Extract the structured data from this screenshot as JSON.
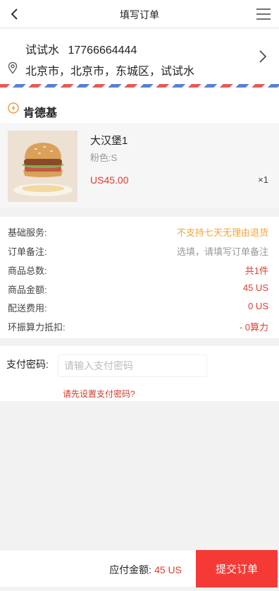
{
  "header": {
    "title": "填写订单",
    "back_icon": "back-arrow-icon",
    "menu_icon": "hamburger-menu-icon"
  },
  "address": {
    "name": "试试水",
    "phone": "17766664444",
    "full_address": "北京市，北京市，东城区，试试水",
    "pin_icon": "location-pin-icon",
    "arrow_icon": "chevron-right-icon"
  },
  "shop": {
    "name": "肯德基",
    "icon": "lightning-icon",
    "accent": "#f28a2e"
  },
  "product": {
    "name": "大汉堡1",
    "variant": "粉色:S",
    "price": "US45.00",
    "quantity": "×1"
  },
  "details": [
    {
      "label": "基础服务:",
      "value": "不支持七天无理由退货",
      "tone": "orange"
    },
    {
      "label": "订单备注:",
      "value": "选填，请填写订单备注",
      "tone": "gray"
    },
    {
      "label": "商品总数:",
      "value": "共1件",
      "tone": "red"
    },
    {
      "label": "商品金额:",
      "value": "45 US",
      "tone": "red"
    },
    {
      "label": "配送费用:",
      "value": "0 US",
      "tone": "red"
    },
    {
      "label": "环振算力抵扣:",
      "value": "- 0算力",
      "tone": "red"
    }
  ],
  "payment": {
    "label": "支付密码:",
    "placeholder": "请输入支付密码",
    "set_password_link": "请先设置支付密码?"
  },
  "footer": {
    "total_label": "应付金额:",
    "total_amount": "45 US",
    "submit_label": "提交订单"
  },
  "colors": {
    "accent_red": "#f53a36",
    "price_red": "#e33b2e",
    "notice_orange": "#f0a43a"
  }
}
